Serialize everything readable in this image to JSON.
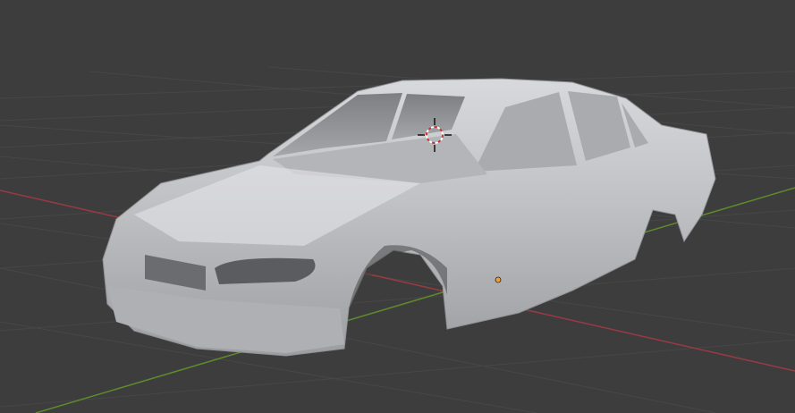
{
  "viewport": {
    "background_color": "#3d3d3d",
    "grid_color": "#474747",
    "x_axis_color": "#9a3a44",
    "y_axis_color": "#5e8a2c",
    "model_color": "#c8cacd",
    "origin_color": "#f0a030",
    "cursor_color": "#d03030"
  },
  "scene": {
    "object": "car-body-mesh",
    "icons": [
      "3d-cursor-icon",
      "origin-point-icon"
    ]
  }
}
